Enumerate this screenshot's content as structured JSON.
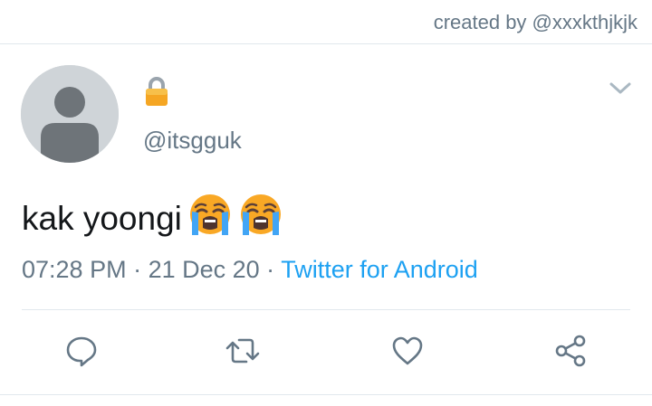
{
  "credit": "created by @xxxkthjkjk",
  "tweet": {
    "handle": "@itsgguk",
    "text": "kak yoongi",
    "emojis": [
      "loudly-crying-face",
      "loudly-crying-face"
    ],
    "time": "07:28 PM",
    "sep1": " · ",
    "date": "21 Dec 20",
    "sep2": " · ",
    "source": "Twitter for Android"
  },
  "icons": {
    "lock": "lock-icon",
    "caret": "chevron-down-icon",
    "reply": "reply-icon",
    "retweet": "retweet-icon",
    "like": "heart-icon",
    "share": "share-icon"
  },
  "colors": {
    "link": "#1da1f2",
    "muted": "#657786",
    "text": "#14171a"
  }
}
